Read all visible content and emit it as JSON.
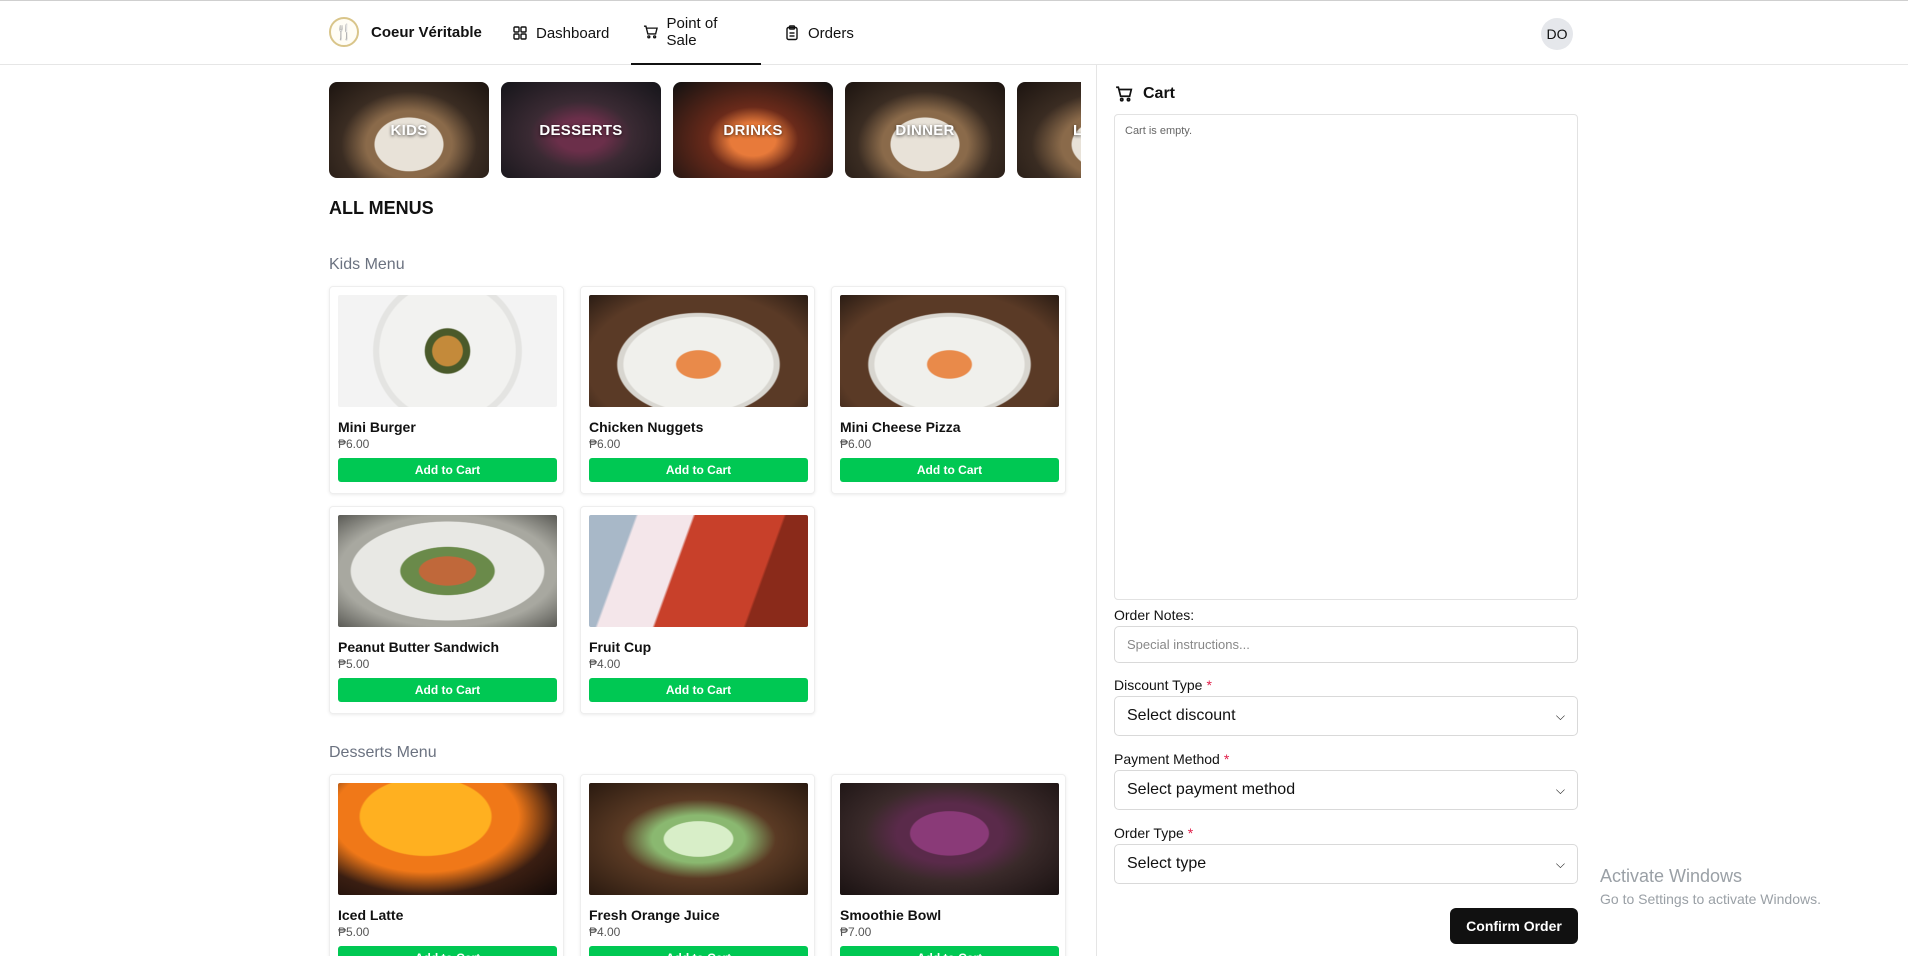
{
  "header": {
    "brand_name": "Coeur Véritable",
    "nav": [
      {
        "label": "Dashboard",
        "icon": "grid-icon"
      },
      {
        "label": "Point of Sale",
        "icon": "cart-icon"
      },
      {
        "label": "Orders",
        "icon": "clipboard-icon"
      }
    ],
    "active_nav": "Point of Sale",
    "avatar_initials": "DO"
  },
  "categories": [
    "KIDS",
    "DESSERTS",
    "DRINKS",
    "DINNER",
    "L"
  ],
  "all_menus_label": "ALL MENUS",
  "sections": [
    {
      "title": "Kids Menu",
      "items": [
        {
          "name": "Mini Burger",
          "price": "₱6.00",
          "button": "Add to Cart"
        },
        {
          "name": "Chicken Nuggets",
          "price": "₱6.00",
          "button": "Add to Cart"
        },
        {
          "name": "Mini Cheese Pizza",
          "price": "₱6.00",
          "button": "Add to Cart"
        },
        {
          "name": "Peanut Butter Sandwich",
          "price": "₱5.00",
          "button": "Add to Cart"
        },
        {
          "name": "Fruit Cup",
          "price": "₱4.00",
          "button": "Add to Cart"
        }
      ]
    },
    {
      "title": "Desserts Menu",
      "items": [
        {
          "name": "Iced Latte",
          "price": "₱5.00",
          "button": "Add to Cart"
        },
        {
          "name": "Fresh Orange Juice",
          "price": "₱4.00",
          "button": "Add to Cart"
        },
        {
          "name": "Smoothie Bowl",
          "price": "₱7.00",
          "button": "Add to Cart"
        }
      ]
    }
  ],
  "cart": {
    "title": "Cart",
    "empty_text": "Cart is empty.",
    "order_notes_label": "Order Notes:",
    "order_notes_placeholder": "Special instructions...",
    "discount_label": "Discount Type",
    "discount_value": "Select discount",
    "payment_label": "Payment Method",
    "payment_value": "Select payment method",
    "order_type_label": "Order Type",
    "order_type_value": "Select type",
    "required_marker": "*",
    "confirm_label": "Confirm Order"
  },
  "watermark": {
    "line1": "Activate Windows",
    "line2": "Go to Settings to activate Windows."
  },
  "colors": {
    "add_button": "#00c853",
    "confirm_button": "#111111",
    "required": "#e11d48"
  }
}
